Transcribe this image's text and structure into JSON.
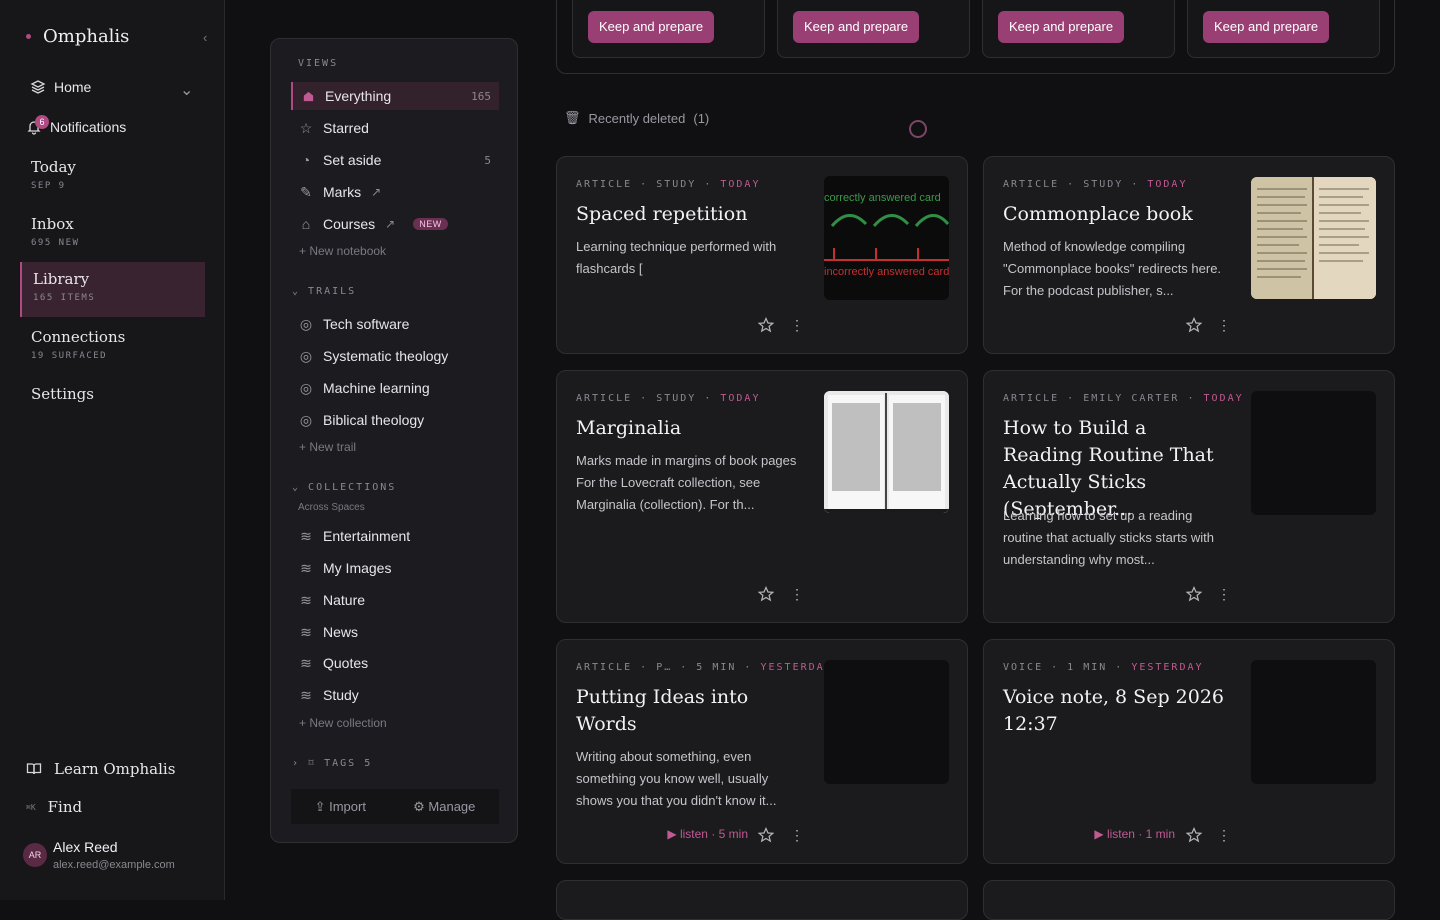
{
  "app": {
    "name": "Omphalis"
  },
  "sidebar": {
    "home": "Home",
    "notifications": "Notifications",
    "notification_count": "6",
    "sections": [
      {
        "title": "Today",
        "sub": "SEP 9"
      },
      {
        "title": "Inbox",
        "sub": "695 NEW"
      },
      {
        "title": "Library",
        "sub": "165 ITEMS"
      },
      {
        "title": "Connections",
        "sub": "19 SURFACED"
      },
      {
        "title": "Settings",
        "sub": ""
      }
    ],
    "learn": "Learn Omphalis",
    "find_shortcut": "⌘K",
    "find": "Find",
    "user": {
      "initials": "AR",
      "name": "Alex Reed",
      "email": "alex.reed@example.com"
    }
  },
  "views_panel": {
    "views_label": "VIEWS",
    "views": [
      {
        "label": "Everything",
        "count": "165"
      },
      {
        "label": "Starred",
        "count": ""
      },
      {
        "label": "Set aside",
        "count": "5"
      },
      {
        "label": "Marks",
        "count": ""
      },
      {
        "label": "Courses",
        "count": "",
        "badge": "NEW"
      }
    ],
    "new_notebook": "New notebook",
    "trails_label": "TRAILS",
    "trails": [
      "Tech software",
      "Systematic theology",
      "Machine learning",
      "Biblical theology"
    ],
    "new_trail": "New trail",
    "collections_label": "COLLECTIONS",
    "collections_sub": "Across Spaces",
    "collections": [
      "Entertainment",
      "My Images",
      "Nature",
      "News",
      "Quotes",
      "Study"
    ],
    "new_collection": "New collection",
    "tags_label": "TAGS 5",
    "import": "Import",
    "manage": "Manage"
  },
  "main": {
    "keep_button": "Keep and prepare",
    "recently_deleted": "Recently deleted",
    "recently_deleted_count": "(1)",
    "cards": [
      {
        "meta": "ARTICLE · STUDY · ",
        "meta_hl": "TODAY",
        "title": "Spaced repetition",
        "desc": "Learning technique performed with flashcards [",
        "thumb_caption_top": "correctly answered card",
        "thumb_caption_bottom": "incorrectly answered card"
      },
      {
        "meta": "ARTICLE · STUDY · ",
        "meta_hl": "TODAY",
        "title": "Commonplace book",
        "desc": "Method of knowledge compiling \"Commonplace books\" redirects here. For the podcast publisher, s..."
      },
      {
        "meta": "ARTICLE · STUDY · ",
        "meta_hl": "TODAY",
        "title": "Marginalia",
        "desc": "Marks made in margins of book pages For the Lovecraft collection, see Marginalia (collection). For th..."
      },
      {
        "meta": "ARTICLE · EMILY CARTER · ",
        "meta_hl": "TODAY",
        "title": "How to Build a Reading Routine That Actually Sticks (September...",
        "desc": "Learning how to set up a reading routine that actually sticks starts with understanding why most..."
      },
      {
        "meta": "ARTICLE · P… · 5 MIN · ",
        "meta_hl": "YESTERDAY",
        "title": "Putting Ideas into Words",
        "desc": "Writing about something, even something you know well, usually shows you that you didn't know it...",
        "listen": "▶ listen · 5 min"
      },
      {
        "meta": "VOICE · 1 MIN · ",
        "meta_hl": "YESTERDAY",
        "title": "Voice note, 8 Sep 2026 12:37",
        "desc": "",
        "listen": "▶ listen · 1 min"
      }
    ]
  }
}
